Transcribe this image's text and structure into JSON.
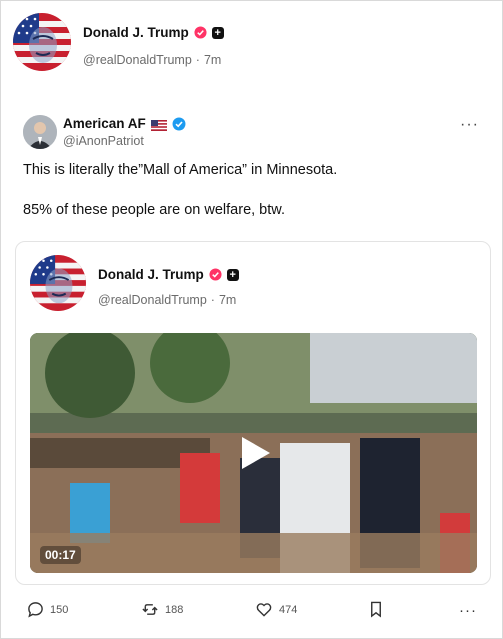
{
  "post": {
    "author_name": "Donald J. Trump",
    "handle": "@realDonaldTrump",
    "time": "7m"
  },
  "repost": {
    "author_name": "American AF",
    "flag": "🇺🇸",
    "handle": "@iAnonPatriot",
    "line1": "This is literally the”Mall of America” in Minnesota.",
    "line2": "85% of these people are on welfare, btw."
  },
  "quoted": {
    "author_name": "Donald J. Trump",
    "handle": "@realDonaldTrump",
    "time": "7m",
    "video_duration": "00:17"
  },
  "actions": {
    "replies": "150",
    "reposts": "188",
    "likes": "474"
  },
  "icons": {
    "verified_pink": "verified-badge-pink-icon",
    "plus_badge": "plus-badge-icon",
    "verified_blue": "verified-badge-blue-icon",
    "reply": "speech-bubble-icon",
    "repost": "repost-arrows-icon",
    "like": "heart-icon",
    "bookmark": "bookmark-icon",
    "more": "more-dots-icon",
    "play": "play-icon"
  },
  "colors": {
    "verified_pink": "#ff3366",
    "verified_blue": "#1d9bf0",
    "muted_text": "#6b6b6b"
  }
}
